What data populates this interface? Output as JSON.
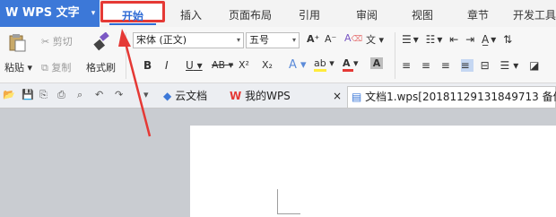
{
  "app": {
    "logo_text": "W WPS 文字",
    "logo_menu_arrow": "▾"
  },
  "ribbon_tabs": [
    "开始",
    "插入",
    "页面布局",
    "引用",
    "审阅",
    "视图",
    "章节",
    "开发工具"
  ],
  "ribbon": {
    "paste_label": "粘贴",
    "cut_label": "剪切",
    "copy_label": "复制",
    "format_painter_label": "格式刷",
    "font_name": "宋体 (正文)",
    "font_size": "五号",
    "grow_font": "A⁺",
    "shrink_font": "A⁻",
    "clear_format": "A",
    "pinyin": "文",
    "bold": "B",
    "italic": "I",
    "underline": "U",
    "strikethrough": "AB",
    "superscript": "X²",
    "subscript": "X₂",
    "text_effect": "A",
    "highlight": "ab",
    "font_color": "A",
    "char_shading": "A"
  },
  "doc_tabs": {
    "cloud_docs": "云文档",
    "my_wps": "我的WPS",
    "active_doc": "文档1.wps[20181129131849713 备份",
    "close_glyph": "×"
  },
  "colors": {
    "logo_bg": "#3c78d8",
    "active_tab_text": "#2f6bd5",
    "annotation_red": "#e53935",
    "font_color_bar": "#e53935",
    "highlight_bar": "#ffeb3b"
  },
  "icons": [
    "cut-icon",
    "copy-icon",
    "paste-icon",
    "format-painter-icon",
    "open-icon",
    "save-icon",
    "print-icon",
    "undo-icon",
    "redo-icon",
    "cloud-icon",
    "wps-logo-icon",
    "document-icon"
  ]
}
